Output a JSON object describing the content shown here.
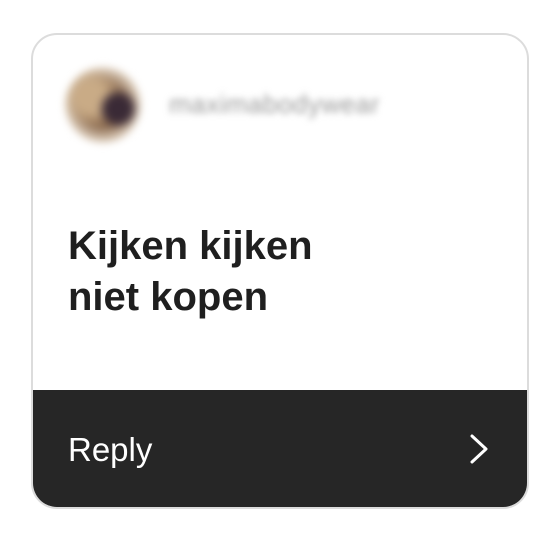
{
  "sender": {
    "username": "maximabodywear",
    "avatar_icon": "profile-avatar"
  },
  "message": {
    "text": "Kijken kijken\nniet kopen"
  },
  "reply": {
    "label": "Reply",
    "icon": "chevron-right-icon"
  },
  "colors": {
    "reply_bar": "#262626",
    "card_border": "#dcdcdc",
    "message_text": "#1f1f1f"
  }
}
